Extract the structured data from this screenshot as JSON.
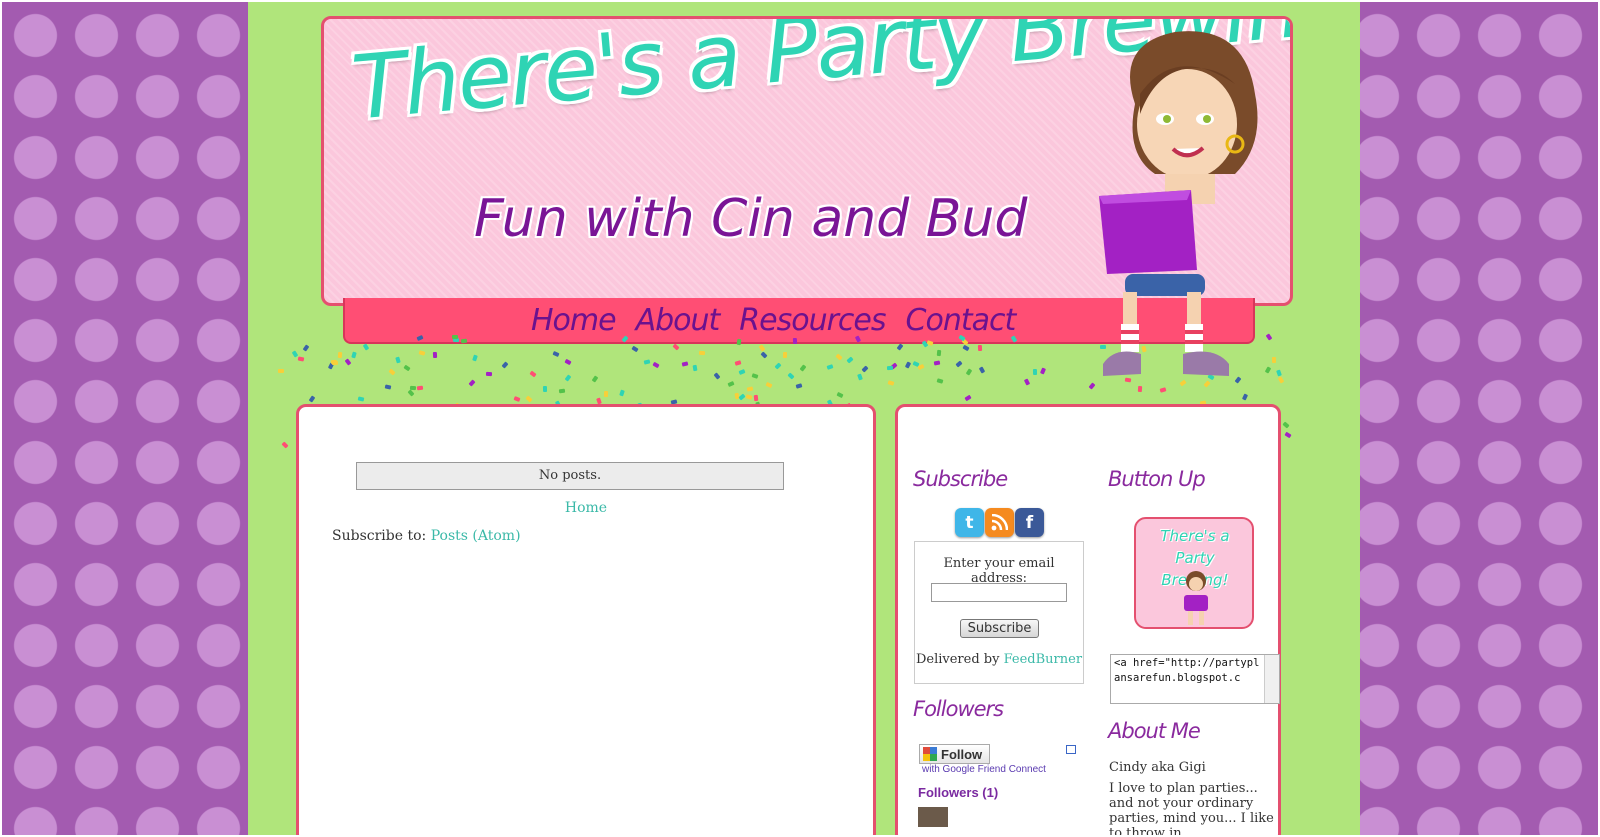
{
  "header": {
    "title": "There's a Party Brewing!",
    "subtitle": "Fun with Cin and Bud"
  },
  "nav": {
    "items": [
      {
        "label": "Home"
      },
      {
        "label": "About"
      },
      {
        "label": "Resources"
      },
      {
        "label": "Contact"
      }
    ]
  },
  "main": {
    "no_posts": "No posts.",
    "home_link": "Home",
    "subscribe_prefix": "Subscribe to: ",
    "subscribe_link": "Posts (Atom)"
  },
  "sidebar": {
    "subscribe": {
      "title": "Subscribe",
      "icons": [
        "twitter-icon",
        "rss-icon",
        "facebook-icon"
      ],
      "email_label": "Enter your email address:",
      "email_value": "",
      "button_label": "Subscribe",
      "delivered_prefix": "Delivered by ",
      "delivered_link": "FeedBurner"
    },
    "followers": {
      "title": "Followers",
      "follow_button": "Follow",
      "gfc_note": "with Google Friend Connect",
      "count_label": "Followers (1)"
    },
    "button_up": {
      "title": "Button Up",
      "button_text": "There's a Party Brewing!",
      "code": "<a href=\"http://partyplansarefun.blogspot.c"
    },
    "about": {
      "title": "About Me",
      "name": "Cindy aka Gigi",
      "description": "I love to plan parties... and not your ordinary parties, mind you... I like to throw in"
    }
  },
  "colors": {
    "page_green": "#b0e57b",
    "polka_purple": "#a35bb0",
    "banner_pink": "#fbc7dc",
    "border_red": "#e4506f",
    "nav_red": "#ff4e74",
    "title_teal": "#2fd4b4",
    "subtitle_purple": "#7a1596",
    "link_teal": "#3bb9a8"
  }
}
